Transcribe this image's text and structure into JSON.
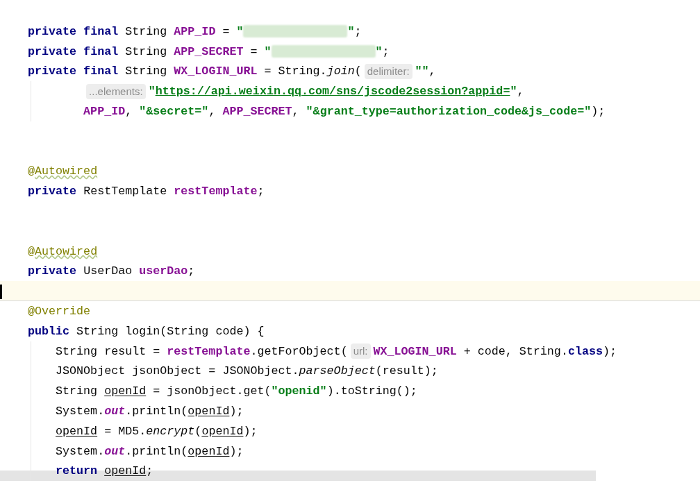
{
  "editor": {
    "lines": [
      {
        "kind": "code",
        "current": false,
        "tokens": [
          {
            "kind": "keyword",
            "text": "private final "
          },
          {
            "kind": "plain",
            "text": "String "
          },
          {
            "kind": "field",
            "text": "APP_ID"
          },
          {
            "kind": "plain",
            "text": " = "
          },
          {
            "kind": "string",
            "text": "\""
          },
          {
            "kind": "redacted"
          },
          {
            "kind": "string",
            "text": "\""
          },
          {
            "kind": "plain",
            "text": ";"
          }
        ]
      },
      {
        "kind": "code",
        "current": false,
        "tokens": [
          {
            "kind": "keyword",
            "text": "private final "
          },
          {
            "kind": "plain",
            "text": "String "
          },
          {
            "kind": "field",
            "text": "APP_SECRET"
          },
          {
            "kind": "plain",
            "text": " = "
          },
          {
            "kind": "string",
            "text": "\""
          },
          {
            "kind": "redacted"
          },
          {
            "kind": "string",
            "text": "\""
          },
          {
            "kind": "plain",
            "text": ";"
          }
        ]
      },
      {
        "kind": "code",
        "current": false,
        "tokens": [
          {
            "kind": "keyword",
            "text": "private final "
          },
          {
            "kind": "plain",
            "text": "String "
          },
          {
            "kind": "field",
            "text": "WX_LOGIN_URL"
          },
          {
            "kind": "plain",
            "text": " = String."
          },
          {
            "kind": "italic",
            "text": "join"
          },
          {
            "kind": "plain",
            "text": "("
          },
          {
            "kind": "hint",
            "text": "delimiter:"
          },
          {
            "kind": "string",
            "text": "\"\""
          },
          {
            "kind": "plain",
            "text": ","
          }
        ]
      },
      {
        "kind": "continuation",
        "current": false,
        "tokens": [
          {
            "kind": "hint",
            "text": "...elements:"
          },
          {
            "kind": "string",
            "text": "\""
          },
          {
            "kind": "link",
            "text": "https://api.weixin.qq.com/sns/jscode2session?appid="
          },
          {
            "kind": "string",
            "text": "\""
          },
          {
            "kind": "plain",
            "text": ","
          }
        ]
      },
      {
        "kind": "continuation",
        "current": false,
        "tokens": [
          {
            "kind": "field",
            "text": "APP_ID"
          },
          {
            "kind": "plain",
            "text": ", "
          },
          {
            "kind": "string",
            "text": "\"&secret=\""
          },
          {
            "kind": "plain",
            "text": ", "
          },
          {
            "kind": "field",
            "text": "APP_SECRET"
          },
          {
            "kind": "plain",
            "text": ", "
          },
          {
            "kind": "string",
            "text": "\"&grant_type=authorization_code&js_code=\""
          },
          {
            "kind": "plain",
            "text": ");"
          }
        ]
      },
      {
        "kind": "blank",
        "current": false
      },
      {
        "kind": "blank",
        "current": false
      },
      {
        "kind": "code",
        "current": false,
        "tokens": [
          {
            "kind": "annotation",
            "text": "@"
          },
          {
            "kind": "annotation-warn",
            "text": "Autowired"
          }
        ]
      },
      {
        "kind": "code",
        "current": false,
        "tokens": [
          {
            "kind": "keyword",
            "text": "private "
          },
          {
            "kind": "plain",
            "text": "RestTemplate "
          },
          {
            "kind": "field",
            "text": "restTemplate"
          },
          {
            "kind": "plain",
            "text": ";"
          }
        ]
      },
      {
        "kind": "blank",
        "current": false
      },
      {
        "kind": "blank",
        "current": false
      },
      {
        "kind": "code",
        "current": false,
        "tokens": [
          {
            "kind": "annotation",
            "text": "@"
          },
          {
            "kind": "annotation-warn",
            "text": "Autowired"
          }
        ]
      },
      {
        "kind": "code",
        "current": false,
        "tokens": [
          {
            "kind": "keyword",
            "text": "private "
          },
          {
            "kind": "plain",
            "text": "UserDao "
          },
          {
            "kind": "field",
            "text": "userDao"
          },
          {
            "kind": "plain",
            "text": ";"
          }
        ]
      },
      {
        "kind": "blank",
        "current": true
      },
      {
        "kind": "code",
        "current": false,
        "tokens": [
          {
            "kind": "annotation",
            "text": "@Override"
          }
        ]
      },
      {
        "kind": "code",
        "current": false,
        "tokens": [
          {
            "kind": "keyword",
            "text": "public "
          },
          {
            "kind": "plain",
            "text": "String login(String code) {"
          }
        ]
      },
      {
        "kind": "body",
        "current": false,
        "tokens": [
          {
            "kind": "plain",
            "text": "String result = "
          },
          {
            "kind": "field",
            "text": "restTemplate"
          },
          {
            "kind": "plain",
            "text": ".getForObject("
          },
          {
            "kind": "hint",
            "text": "url:"
          },
          {
            "kind": "field",
            "text": "WX_LOGIN_URL"
          },
          {
            "kind": "plain",
            "text": " + code, String."
          },
          {
            "kind": "keyword",
            "text": "class"
          },
          {
            "kind": "plain",
            "text": ");"
          }
        ]
      },
      {
        "kind": "body",
        "current": false,
        "tokens": [
          {
            "kind": "plain",
            "text": "JSONObject jsonObject = JSONObject."
          },
          {
            "kind": "italic",
            "text": "parseObject"
          },
          {
            "kind": "plain",
            "text": "(result);"
          }
        ]
      },
      {
        "kind": "body",
        "current": false,
        "tokens": [
          {
            "kind": "plain",
            "text": "String "
          },
          {
            "kind": "var",
            "text": "openId"
          },
          {
            "kind": "plain",
            "text": " = jsonObject.get("
          },
          {
            "kind": "string",
            "text": "\"openid\""
          },
          {
            "kind": "plain",
            "text": ").toString();"
          }
        ]
      },
      {
        "kind": "body",
        "current": false,
        "tokens": [
          {
            "kind": "plain",
            "text": "System."
          },
          {
            "kind": "static-field",
            "text": "out"
          },
          {
            "kind": "plain",
            "text": ".println("
          },
          {
            "kind": "var",
            "text": "openId"
          },
          {
            "kind": "plain",
            "text": ");"
          }
        ]
      },
      {
        "kind": "body",
        "current": false,
        "tokens": [
          {
            "kind": "var",
            "text": "openId"
          },
          {
            "kind": "plain",
            "text": " = MD5."
          },
          {
            "kind": "italic",
            "text": "encrypt"
          },
          {
            "kind": "plain",
            "text": "("
          },
          {
            "kind": "var",
            "text": "openId"
          },
          {
            "kind": "plain",
            "text": ");"
          }
        ]
      },
      {
        "kind": "body",
        "current": false,
        "tokens": [
          {
            "kind": "plain",
            "text": "System."
          },
          {
            "kind": "static-field",
            "text": "out"
          },
          {
            "kind": "plain",
            "text": ".println("
          },
          {
            "kind": "var",
            "text": "openId"
          },
          {
            "kind": "plain",
            "text": ");"
          }
        ]
      },
      {
        "kind": "body",
        "current": false,
        "tokens": [
          {
            "kind": "keyword",
            "text": "return "
          },
          {
            "kind": "var",
            "text": "openId"
          },
          {
            "kind": "plain",
            "text": ";"
          }
        ]
      }
    ]
  }
}
